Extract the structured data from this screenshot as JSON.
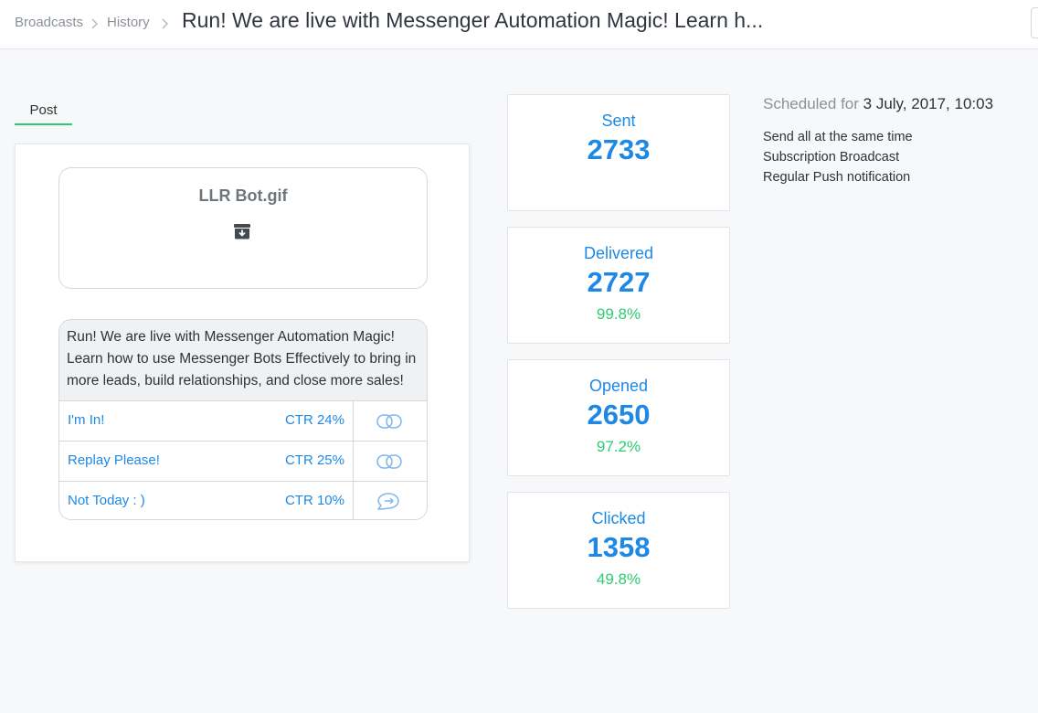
{
  "breadcrumb": {
    "items": [
      "Broadcasts",
      "History"
    ]
  },
  "page_title": "Run! We are live with Messenger Automation Magic! Learn h...",
  "tabs": [
    {
      "label": "Post",
      "active": true
    }
  ],
  "post": {
    "media_filename": "LLR Bot.gif",
    "media_icon": "download-box-icon",
    "message_text": "Run! We are live with Messenger Automation Magic! Learn how to use Messenger Bots Effectively to bring in more leads, build relationships, and close more sales!",
    "buttons": [
      {
        "label": "I'm In!",
        "ctr": "CTR 24%",
        "icon": "link-icon"
      },
      {
        "label": "Replay Please!",
        "ctr": "CTR 25%",
        "icon": "link-icon"
      },
      {
        "label": "Not Today : )",
        "ctr": "CTR 10%",
        "icon": "reply-bubble-icon"
      }
    ]
  },
  "stats": [
    {
      "label": "Sent",
      "value": "2733"
    },
    {
      "label": "Delivered",
      "value": "2727",
      "percent": "99.8%"
    },
    {
      "label": "Opened",
      "value": "2650",
      "percent": "97.2%"
    },
    {
      "label": "Clicked",
      "value": "1358",
      "percent": "49.8%"
    }
  ],
  "schedule": {
    "prefix": "Scheduled for",
    "datetime": "3 July, 2017, 10:03",
    "options": [
      "Send all at the same time",
      "Subscription Broadcast",
      "Regular Push notification"
    ]
  },
  "colors": {
    "accent_blue": "#1e88e5",
    "success_green": "#2ecc71",
    "muted_gray": "#8b9199"
  }
}
